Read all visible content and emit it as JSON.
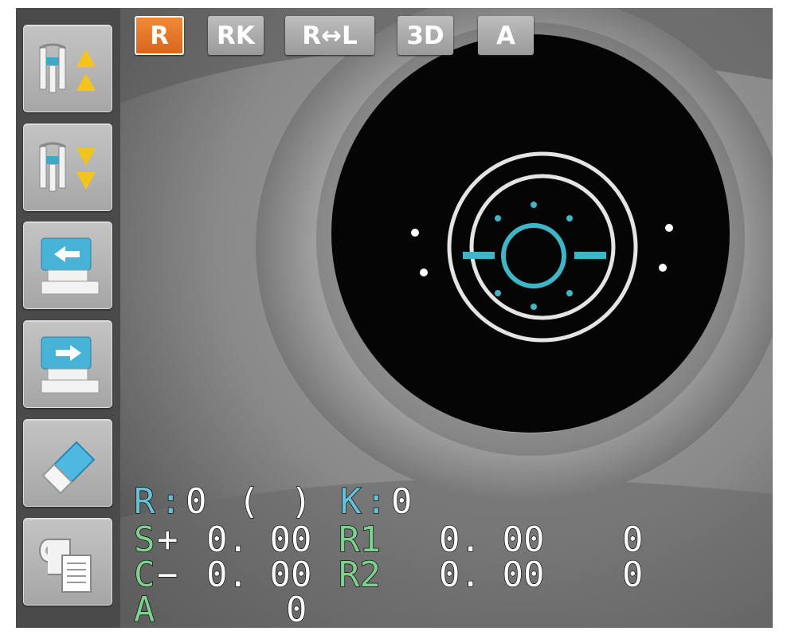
{
  "mode_buttons": [
    {
      "label": "R",
      "active": true
    },
    {
      "label": "RK",
      "active": false
    },
    {
      "label": "R↔L",
      "active": false
    },
    {
      "label": "3D",
      "active": false
    },
    {
      "label": "A",
      "active": false
    }
  ],
  "sidebar": {
    "buttons": [
      {
        "icon": "chinrest-up-icon"
      },
      {
        "icon": "chinrest-down-icon"
      },
      {
        "icon": "move-head-left-icon"
      },
      {
        "icon": "move-head-right-icon"
      },
      {
        "icon": "eraser-icon"
      },
      {
        "icon": "print-icon"
      }
    ]
  },
  "readout": {
    "r_label": "R",
    "r_colon": ":",
    "r_value": "0",
    "r_paren_open": "(",
    "r_paren_close": ")",
    "k_label": "K",
    "k_colon": ":",
    "k_value": "0",
    "s_label": "S",
    "s_sign": "+",
    "s_value": "0. 00",
    "c_label": "C",
    "c_sign": "−",
    "c_value": "0. 00",
    "a_label": "A",
    "a_value": "0",
    "r1_label": "R1",
    "r1_value": "0. 00",
    "r1_axis": "0",
    "r2_label": "R2",
    "r2_value": "0. 00",
    "r2_axis": "0"
  },
  "colors": {
    "active_button": "#e8772a",
    "alignment_mark": "#3fb6c8",
    "cyan_label": "#68c0d8",
    "green_label": "#7fcf8f"
  }
}
